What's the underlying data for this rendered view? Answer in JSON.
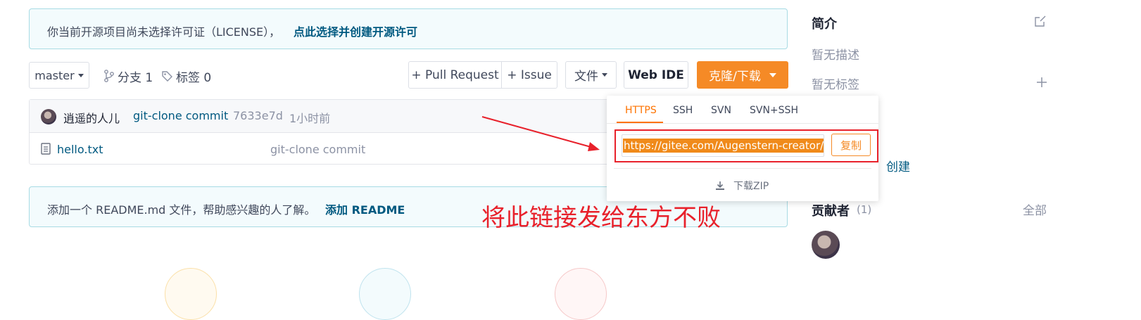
{
  "license_notice": {
    "text": "你当前开源项目尚未选择许可证（LICENSE），",
    "link": "点此选择并创建开源许可"
  },
  "toolbar": {
    "branch_select": "master",
    "branches_label": "分支 1",
    "tags_label": "标签 0",
    "pull_request_btn": "+ Pull Request",
    "issue_btn": "+ Issue",
    "files_btn": "文件",
    "web_ide_btn": "Web IDE",
    "clone_btn": "克隆/下载"
  },
  "commit_bar": {
    "author": "逍遥的人儿",
    "message": "git-clone commit",
    "hash": "7633e7d",
    "time": "1小时前"
  },
  "files": [
    {
      "name": "hello.txt",
      "commit": "git-clone commit"
    }
  ],
  "readme_notice": {
    "text": "添加一个 README.md 文件，帮助感兴趣的人了解。",
    "link": "添加 README"
  },
  "clone_popup": {
    "tabs": [
      "HTTPS",
      "SSH",
      "SVN",
      "SVN+SSH"
    ],
    "active_tab": "HTTPS",
    "url": "https://gitee.com/Augenstern-creator/",
    "copy_btn": "复制",
    "download_zip": "下载ZIP"
  },
  "annotation": {
    "text": "将此链接发给东方不败"
  },
  "sidebar": {
    "intro_title": "简介",
    "no_description": "暂无描述",
    "no_tags": "暂无标签",
    "create_partial": "创建",
    "contributors_title": "贡献者",
    "contributors_count": "(1)",
    "all_link": "全部"
  },
  "colors": {
    "accent_orange": "#fe7300",
    "link_blue": "#005980",
    "annotation_red": "#e8212b",
    "notice_bg": "#f3fbfd"
  }
}
